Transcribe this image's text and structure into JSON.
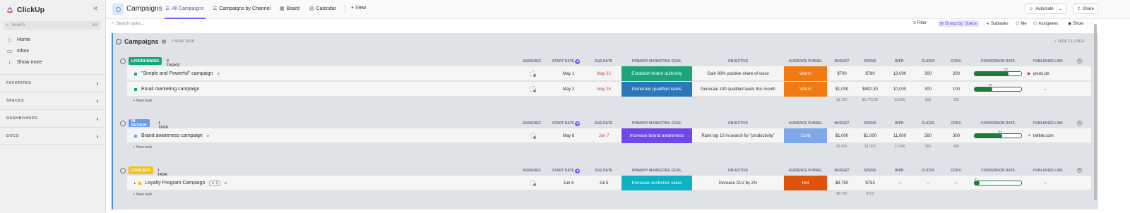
{
  "sidebar": {
    "brand": "ClickUp",
    "search_placeholder": "Search",
    "search_shortcut": "⌘K",
    "nav": [
      {
        "label": "Home",
        "icon": "home-icon"
      },
      {
        "label": "Inbox",
        "icon": "inbox-icon"
      },
      {
        "label": "Show more",
        "icon": "arrow-down-icon"
      }
    ],
    "sections": [
      "FAVORITES",
      "SPACES",
      "DASHBOARDS",
      "DOCS"
    ]
  },
  "topbar": {
    "space": "Campaigns",
    "views": [
      "All Campaigns",
      "Campaigns by Channel",
      "Board",
      "Calendar",
      "+ View"
    ],
    "automate": "Automate",
    "share": "Share"
  },
  "toolbar": {
    "search_placeholder": "Search tasks...",
    "dots": "···",
    "filter": "Filter",
    "group_by": "Group by: Status",
    "subtasks": "Subtasks",
    "me": "Me",
    "assignees": "Assignees",
    "show": "Show",
    "more": "···"
  },
  "list": {
    "title": "Campaigns",
    "new_task": "+ NEW TASK",
    "hide_closed": "HIDE CLOSED"
  },
  "columns": {
    "assignee": "ASSIGNEE",
    "start": "START DATE",
    "due": "DUE DATE",
    "goal": "PRIMARY MARKETING GOAL",
    "objective": "OBJECTIVE",
    "funnel": "AUDIENCE FUNNEL",
    "budget": "BUDGET",
    "spend": "SPEND",
    "impr": "IMPR.",
    "clicks": "CLICKS",
    "conv": "CONV.",
    "rate": "CONVERSION RATE",
    "link": "PUBLISHED LINK"
  },
  "groups": [
    {
      "status": "LIVE/RUNNING",
      "color": "#1aa57a",
      "count": "2 TASKS",
      "new_task": "+ New task",
      "tasks": [
        {
          "name": "\"Simple and Powerful\" campaign",
          "start": "May 1",
          "due": "May 22",
          "due_overdue": true,
          "goal": "Establish brand authority",
          "goal_color": "#1aa57a",
          "objective": "Gain 90% positive share of voice",
          "funnel": "Warm",
          "funnel_color": "#f07b12",
          "budget": "$700",
          "spend": "$780",
          "impr": "13,000",
          "clicks": "300",
          "conv": "200",
          "rate": 0.67,
          "rate_label": "67",
          "link": "youtu.be",
          "link_icon": "youtube-icon"
        },
        {
          "name": "Email marketing campaign",
          "start": "May 2",
          "due": "May 28",
          "due_overdue": true,
          "goal": "Generate qualified leads",
          "goal_color": "#2c77b8",
          "objective": "Generate 100 qualified leads this month",
          "funnel": "Warm",
          "funnel_color": "#f07b12",
          "budget": "$1,000",
          "spend": "$992.30",
          "impr": "10,000",
          "clicks": "300",
          "conv": "100",
          "rate": 0.33,
          "rate_label": "33",
          "link": "–",
          "link_icon": ""
        }
      ],
      "sums": {
        "budget": "$1,700",
        "spend": "$1,772.30",
        "impr": "23,000",
        "clicks": "600",
        "conv": "300"
      }
    },
    {
      "status": "IN REVIEW",
      "color": "#6b9be8",
      "count": "1 TASK",
      "new_task": "+ New task",
      "tasks": [
        {
          "name": "Brand awareness campaign",
          "start": "May 8",
          "due": "Jun 7",
          "due_overdue": true,
          "goal": "Increase brand awareness",
          "goal_color": "#7048e8",
          "objective": "Rank top 10 in search for \"productivity\"",
          "funnel": "Cold",
          "funnel_color": "#7ea8ea",
          "budget": "$1,000",
          "spend": "$1,000",
          "impr": "11,000",
          "clicks": "560",
          "conv": "300",
          "rate": 0.54,
          "rate_label": "54",
          "link": "twitter.com",
          "link_icon": "twitter-icon"
        }
      ],
      "sums": {
        "budget": "$1,000",
        "spend": "$1,000",
        "impr": "11,000",
        "clicks": "560",
        "conv": "300"
      }
    },
    {
      "status": "CONCEPT",
      "color": "#f2c21a",
      "count": "1 TASK",
      "new_task": "+ New task",
      "tasks": [
        {
          "name": "Loyalty Program Campaign",
          "subtasks": "3",
          "start": "Jun 6",
          "due": "Jul 5",
          "due_overdue": false,
          "goal": "Increase customer value",
          "goal_color": "#0fb0c4",
          "objective": "Increase CLV by 2%",
          "funnel": "Hot",
          "funnel_color": "#e0530b",
          "budget": "$8,750",
          "spend": "$753",
          "impr": "–",
          "clicks": "–",
          "conv": "–",
          "rate": 0.0,
          "rate_label": "0",
          "link": "–",
          "link_icon": ""
        }
      ],
      "sums": {
        "budget": "$8,750",
        "spend": "$753",
        "impr": "",
        "clicks": "",
        "conv": ""
      }
    }
  ]
}
